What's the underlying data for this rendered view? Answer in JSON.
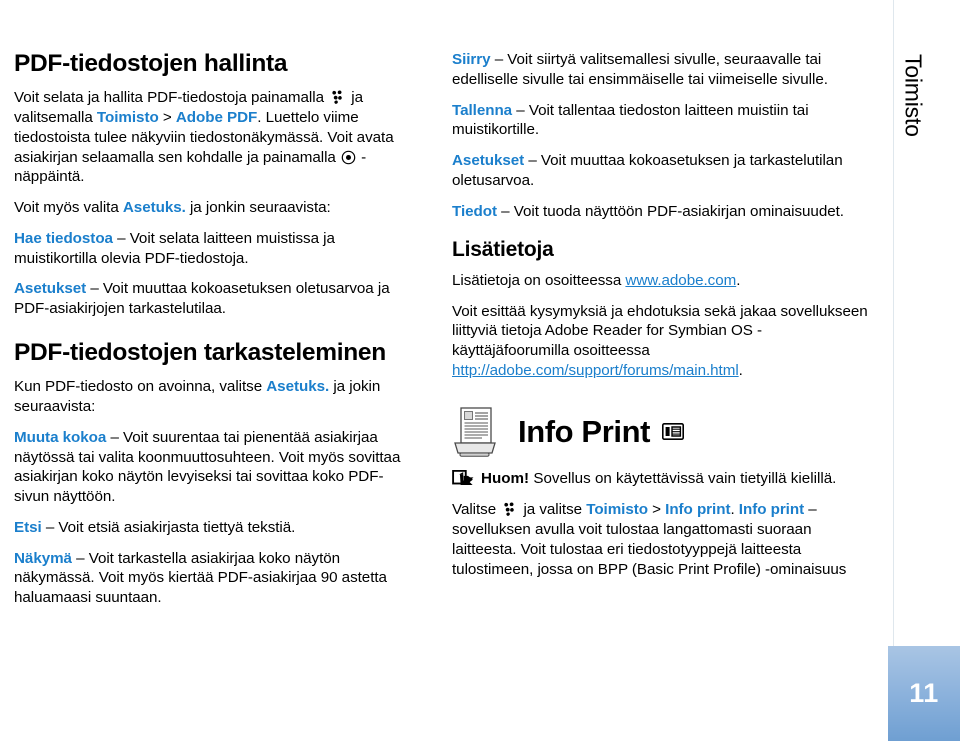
{
  "rail": {
    "chapter_label": "Toimisto",
    "page_number": "11"
  },
  "colors": {
    "link_blue": "#1b7fcc",
    "page_number_bg_top": "#a9c5e4",
    "page_number_bg_bottom": "#6f9fd2",
    "rail_line": "#dfe7ed"
  },
  "left_column": {
    "heading": "PDF-tiedostojen hallinta",
    "intro": {
      "t1": "Voit selata ja hallita PDF-tiedostoja painamalla ",
      "icon1": "menu-key-icon",
      "t2": " ja valitsemalla ",
      "link1": "Toimisto",
      "t3": " > ",
      "link2": "Adobe PDF",
      "t4": ". Luettelo viime tiedostoista tulee näkyviin tiedostonäkymässä. Voit avata asiakirjan selaamalla sen kohdalle ja painamalla ",
      "icon2": "scroll-key-icon",
      "t5": " -näppäintä."
    },
    "options_lead": {
      "t1": "Voit myös valita ",
      "link": "Asetuks.",
      "t2": " ja jonkin seuraavista:"
    },
    "options": [
      {
        "term": "Hae tiedostoa",
        "dash": " – ",
        "desc": "Voit selata laitteen muistissa ja muistikortilla olevia PDF-tiedostoja."
      },
      {
        "term": "Asetukset",
        "dash": " – ",
        "desc": "Voit muuttaa kokoasetuksen oletusarvoa ja PDF-asiakirjojen tarkastelutilaa."
      }
    ],
    "heading2": "PDF-tiedostojen tarkasteleminen",
    "view_lead": {
      "t1": "Kun PDF-tiedosto on avoinna, valitse ",
      "link": "Asetuks.",
      "t2": " ja jokin seuraavista:"
    },
    "view_options": [
      {
        "term": "Muuta kokoa",
        "dash": " – ",
        "desc": "Voit suurentaa tai pienentää asiakirjaa näytössä tai valita koonmuuttosuhteen. Voit myös sovittaa asiakirjan koko näytön levyiseksi tai sovittaa koko PDF-sivun näyttöön."
      },
      {
        "term": "Etsi",
        "dash": " – ",
        "desc": "Voit etsiä asiakirjasta tiettyä tekstiä."
      },
      {
        "term": "Näkymä",
        "dash": " – ",
        "desc": "Voit tarkastella asiakirjaa koko näytön näkymässä. Voit myös kiertää PDF-asiakirjaa 90 astetta haluamaasi suuntaan."
      }
    ]
  },
  "right_column": {
    "options": [
      {
        "term": "Siirry",
        "dash": " – ",
        "desc": "Voit siirtyä valitsemallesi sivulle, seuraavalle tai edelliselle sivulle tai ensimmäiselle tai viimeiselle sivulle."
      },
      {
        "term": "Tallenna",
        "dash": " – ",
        "desc": "Voit tallentaa tiedoston laitteen muistiin tai muistikortille."
      },
      {
        "term": "Asetukset",
        "dash": " – ",
        "desc": "Voit muuttaa kokoasetuksen ja tarkastelutilan oletusarvoa."
      },
      {
        "term": "Tiedot",
        "dash": " – ",
        "desc": "Voit tuoda näyttöön PDF-asiakirjan ominaisuudet."
      }
    ],
    "more_info_heading": "Lisätietoja",
    "more_info_line": {
      "t1": "Lisätietoja on osoitteessa ",
      "url": "www.adobe.com",
      "t2": "."
    },
    "forum_paragraph": {
      "t1": "Voit esittää kysymyksiä ja ehdotuksia sekä jakaa sovellukseen liittyviä tietoja Adobe Reader for Symbian OS -käyttäjäfoorumilla osoitteessa ",
      "url": "http://adobe.com/support/forums/main.html",
      "t2": "."
    },
    "infoprint": {
      "printer_icon": "printer-icon",
      "title": "Info Print",
      "badge_icon": "memory-card-icon"
    },
    "note": {
      "icon": "note-arrow-icon",
      "strong": "Huom!",
      "text": " Sovellus on käytettävissä vain tietyillä kielillä."
    },
    "select_paragraph": {
      "t1": "Valitse ",
      "icon": "menu-key-icon",
      "t2": " ja valitse ",
      "link1": "Toimisto",
      "t3": " > ",
      "link2": "Info print",
      "t4": ". ",
      "link3": "Info print",
      "t5": " – sovelluksen avulla voit tulostaa langattomasti suoraan laitteesta. Voit tulostaa eri tiedostotyyppejä laitteesta tulostimeen, jossa on BPP (Basic Print Profile) -ominaisuus"
    }
  }
}
